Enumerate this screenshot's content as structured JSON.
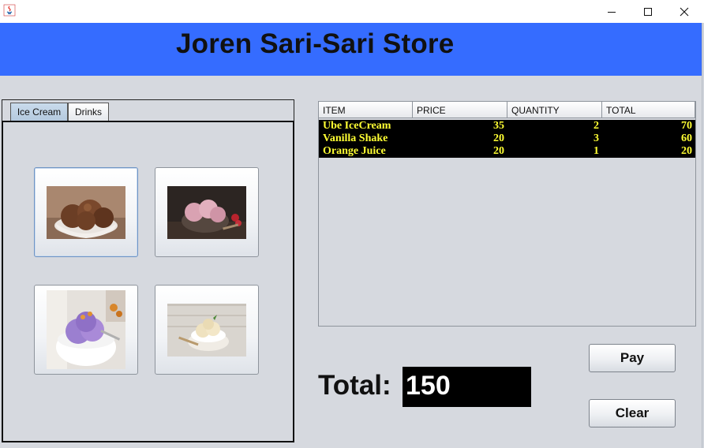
{
  "window": {
    "icons": {
      "app": "java-icon",
      "minimize": "minimize-icon",
      "maximize": "maximize-icon",
      "close": "close-icon"
    }
  },
  "header": {
    "title": "Joren Sari-Sari Store",
    "banner_color": "#356cff"
  },
  "tabs": [
    {
      "label": "Ice Cream",
      "active": true
    },
    {
      "label": "Drinks",
      "active": false
    }
  ],
  "products": [
    {
      "image": "chocolate-ice-cream-bowl"
    },
    {
      "image": "strawberry-ice-cream-bowl"
    },
    {
      "image": "ube-ice-cream-bowl"
    },
    {
      "image": "vanilla-ice-cream-bowl"
    }
  ],
  "table": {
    "columns": [
      "ITEM",
      "PRICE",
      "QUANTITY",
      "TOTAL"
    ],
    "rows": [
      [
        "Ube IceCream",
        "35",
        "2",
        "70"
      ],
      [
        "Vanilla Shake",
        "20",
        "3",
        "60"
      ],
      [
        "Orange Juice",
        "20",
        "1",
        "20"
      ]
    ],
    "row_text_color": "#ffff33",
    "row_bg_color": "#000000"
  },
  "total": {
    "label": "Total:",
    "value": "150"
  },
  "buttons": {
    "pay": "Pay",
    "clear": "Clear"
  }
}
